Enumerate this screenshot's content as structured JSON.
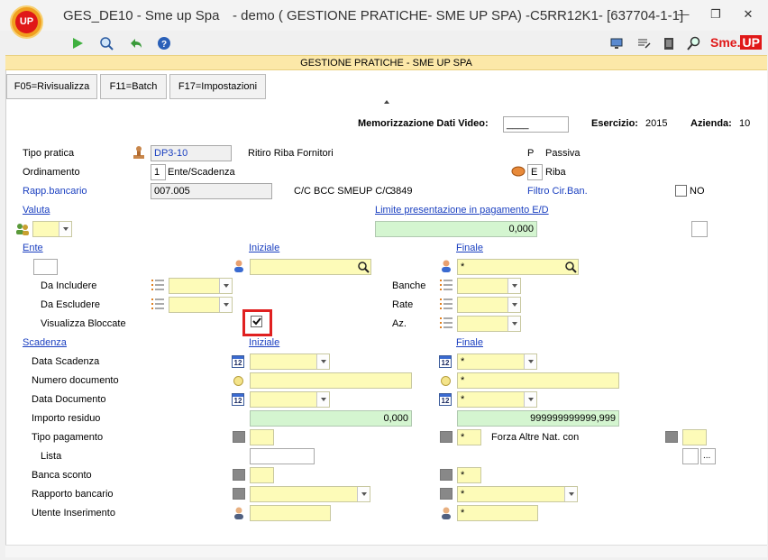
{
  "window": {
    "logo_text": "UP",
    "app_name": "GES_DE10 - Sme up Spa",
    "title": "- demo ( GESTIONE PRATICHE- SME UP SPA) -C5RR12K1- [637704-1-1]",
    "brand": "Sme.",
    "brand_up": "UP"
  },
  "banner": "GESTIONE PRATICHE -  SME UP SPA",
  "fkeys": [
    "F05=Rivisualizza",
    "F11=Batch",
    "F17=Impostazioni"
  ],
  "header": {
    "memo_label": "Memorizzazione Dati Video:",
    "memo_value": "____",
    "esercizio_label": "Esercizio:",
    "esercizio_value": "2015",
    "azienda_label": "Azienda:",
    "azienda_value": "10"
  },
  "form": {
    "tipo_pratica_label": "Tipo pratica",
    "tipo_pratica_value": "DP3-10",
    "tipo_pratica_desc": "Ritiro Riba Fornitori",
    "tipo_p": "P",
    "tipo_passiva": "Passiva",
    "ordinamento_label": "Ordinamento",
    "ordinamento_value": "1",
    "ordinamento_desc": "Ente/Scadenza",
    "ordinamento_e": "E",
    "ordinamento_riba": "Riba",
    "rapp_label": "Rapp.bancario",
    "rapp_value": "007.005",
    "rapp_desc": "C/C BCC SMEUP C/C",
    "rapp_num": "3849",
    "filtro_label": "Filtro Cir.Ban.",
    "filtro_no": "NO",
    "valuta_label": "Valuta",
    "limite_label": "Limite presentazione in pagamento E/D",
    "limite_value": "0,000",
    "ente_label": "Ente",
    "iniziale_label": "Iniziale",
    "finale_label": "Finale",
    "ente_finale_value": "*",
    "da_includere_label": "Da Includere",
    "da_escludere_label": "Da Escludere",
    "vis_bloccate_label": "Visualizza Bloccate",
    "banche_label": "Banche",
    "rate_label": "Rate",
    "az_label": "Az.",
    "scadenza_label": "Scadenza",
    "scad_iniziale_label": "Iniziale",
    "scad_finale_label": "Finale",
    "data_scadenza_label": "Data Scadenza",
    "data_scadenza_fin": "*",
    "numero_documento_label": "Numero documento",
    "numero_documento_fin": "*",
    "data_documento_label": "Data Documento",
    "data_documento_fin": "*",
    "importo_label": "Importo residuo",
    "importo_ini": "0,000",
    "importo_fin": "999999999999,999",
    "tipo_pagamento_label": "Tipo pagamento",
    "tipo_pagamento_fin": "*",
    "forza_label": "Forza Altre Nat. con",
    "lista_label": "Lista",
    "ellipsis": "...",
    "banca_sconto_label": "Banca sconto",
    "banca_sconto_fin": "*",
    "rapporto_label": "Rapporto bancario",
    "rapporto_fin": "*",
    "utente_label": "Utente Inserimento",
    "utente_fin": "*",
    "cal_num": "12"
  }
}
